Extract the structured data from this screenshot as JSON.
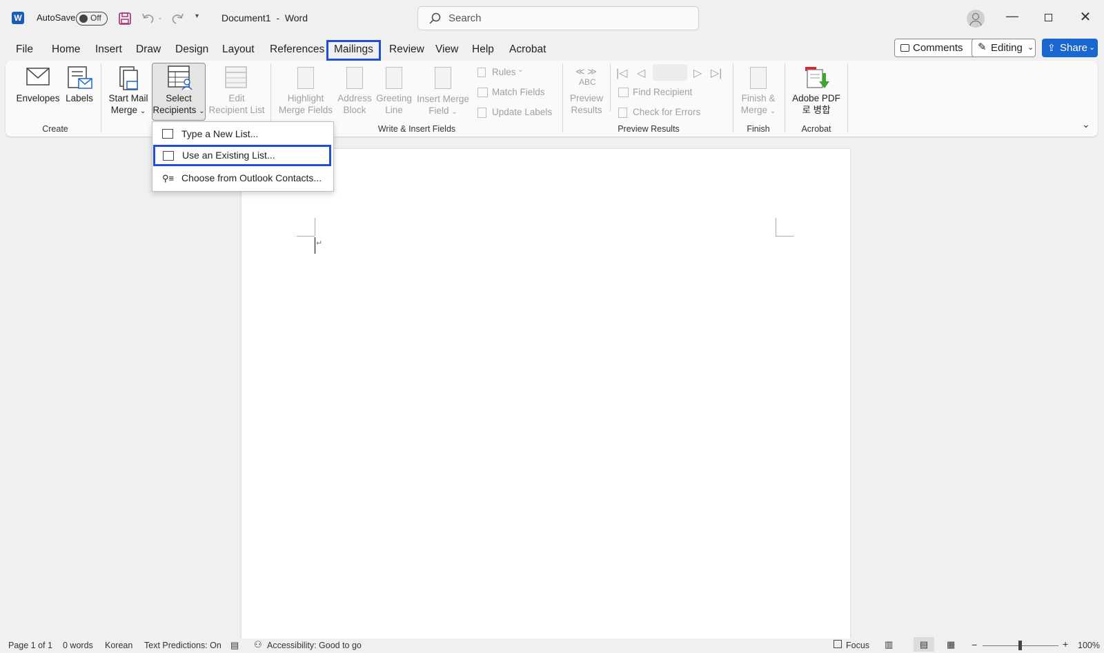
{
  "titlebar": {
    "autosave_label": "AutoSave",
    "autosave_state": "Off",
    "doc_title": "Document1  -  Word",
    "search_placeholder": "Search"
  },
  "menu": {
    "tabs": [
      "File",
      "Home",
      "Insert",
      "Draw",
      "Design",
      "Layout",
      "References",
      "Mailings",
      "Review",
      "View",
      "Help",
      "Acrobat"
    ],
    "active_tab": "Mailings",
    "comments_label": "Comments",
    "editing_label": "Editing",
    "share_label": "Share"
  },
  "ribbon": {
    "create": {
      "envelopes": "Envelopes",
      "labels": "Labels",
      "group": "Create"
    },
    "start": {
      "start_l1": "Start Mail",
      "start_l2": "Merge",
      "select_l1": "Select",
      "select_l2": "Recipients",
      "edit_l1": "Edit",
      "edit_l2": "Recipient List"
    },
    "write": {
      "highlight_l1": "Highlight",
      "highlight_l2": "Merge Fields",
      "address_l1": "Address",
      "address_l2": "Block",
      "greeting_l1": "Greeting",
      "greeting_l2": "Line",
      "insert_l1": "Insert Merge",
      "insert_l2": "Field",
      "rules": "Rules",
      "match": "Match Fields",
      "update": "Update Labels",
      "group": "Write & Insert Fields"
    },
    "preview": {
      "preview_l1": "Preview",
      "preview_l2": "Results",
      "abc": "ABC",
      "find": "Find Recipient",
      "check": "Check for Errors",
      "group": "Preview Results"
    },
    "finish": {
      "l1": "Finish &",
      "l2": "Merge",
      "group": "Finish"
    },
    "acrobat": {
      "l1": "Adobe PDF",
      "l2": "로 병합",
      "group": "Acrobat"
    }
  },
  "dropdown": {
    "items": [
      "Type a New List...",
      "Use an Existing List...",
      "Choose from Outlook Contacts..."
    ],
    "highlighted": "Use an Existing List..."
  },
  "status": {
    "page": "Page 1 of 1",
    "words": "0 words",
    "language": "Korean",
    "predictions": "Text Predictions: On",
    "accessibility": "Accessibility: Good to go",
    "focus": "Focus",
    "zoom": "100%"
  },
  "colors": {
    "accent": "#1a66d1",
    "highlight_border": "#1f4fd6",
    "word_blue": "#185abd"
  }
}
